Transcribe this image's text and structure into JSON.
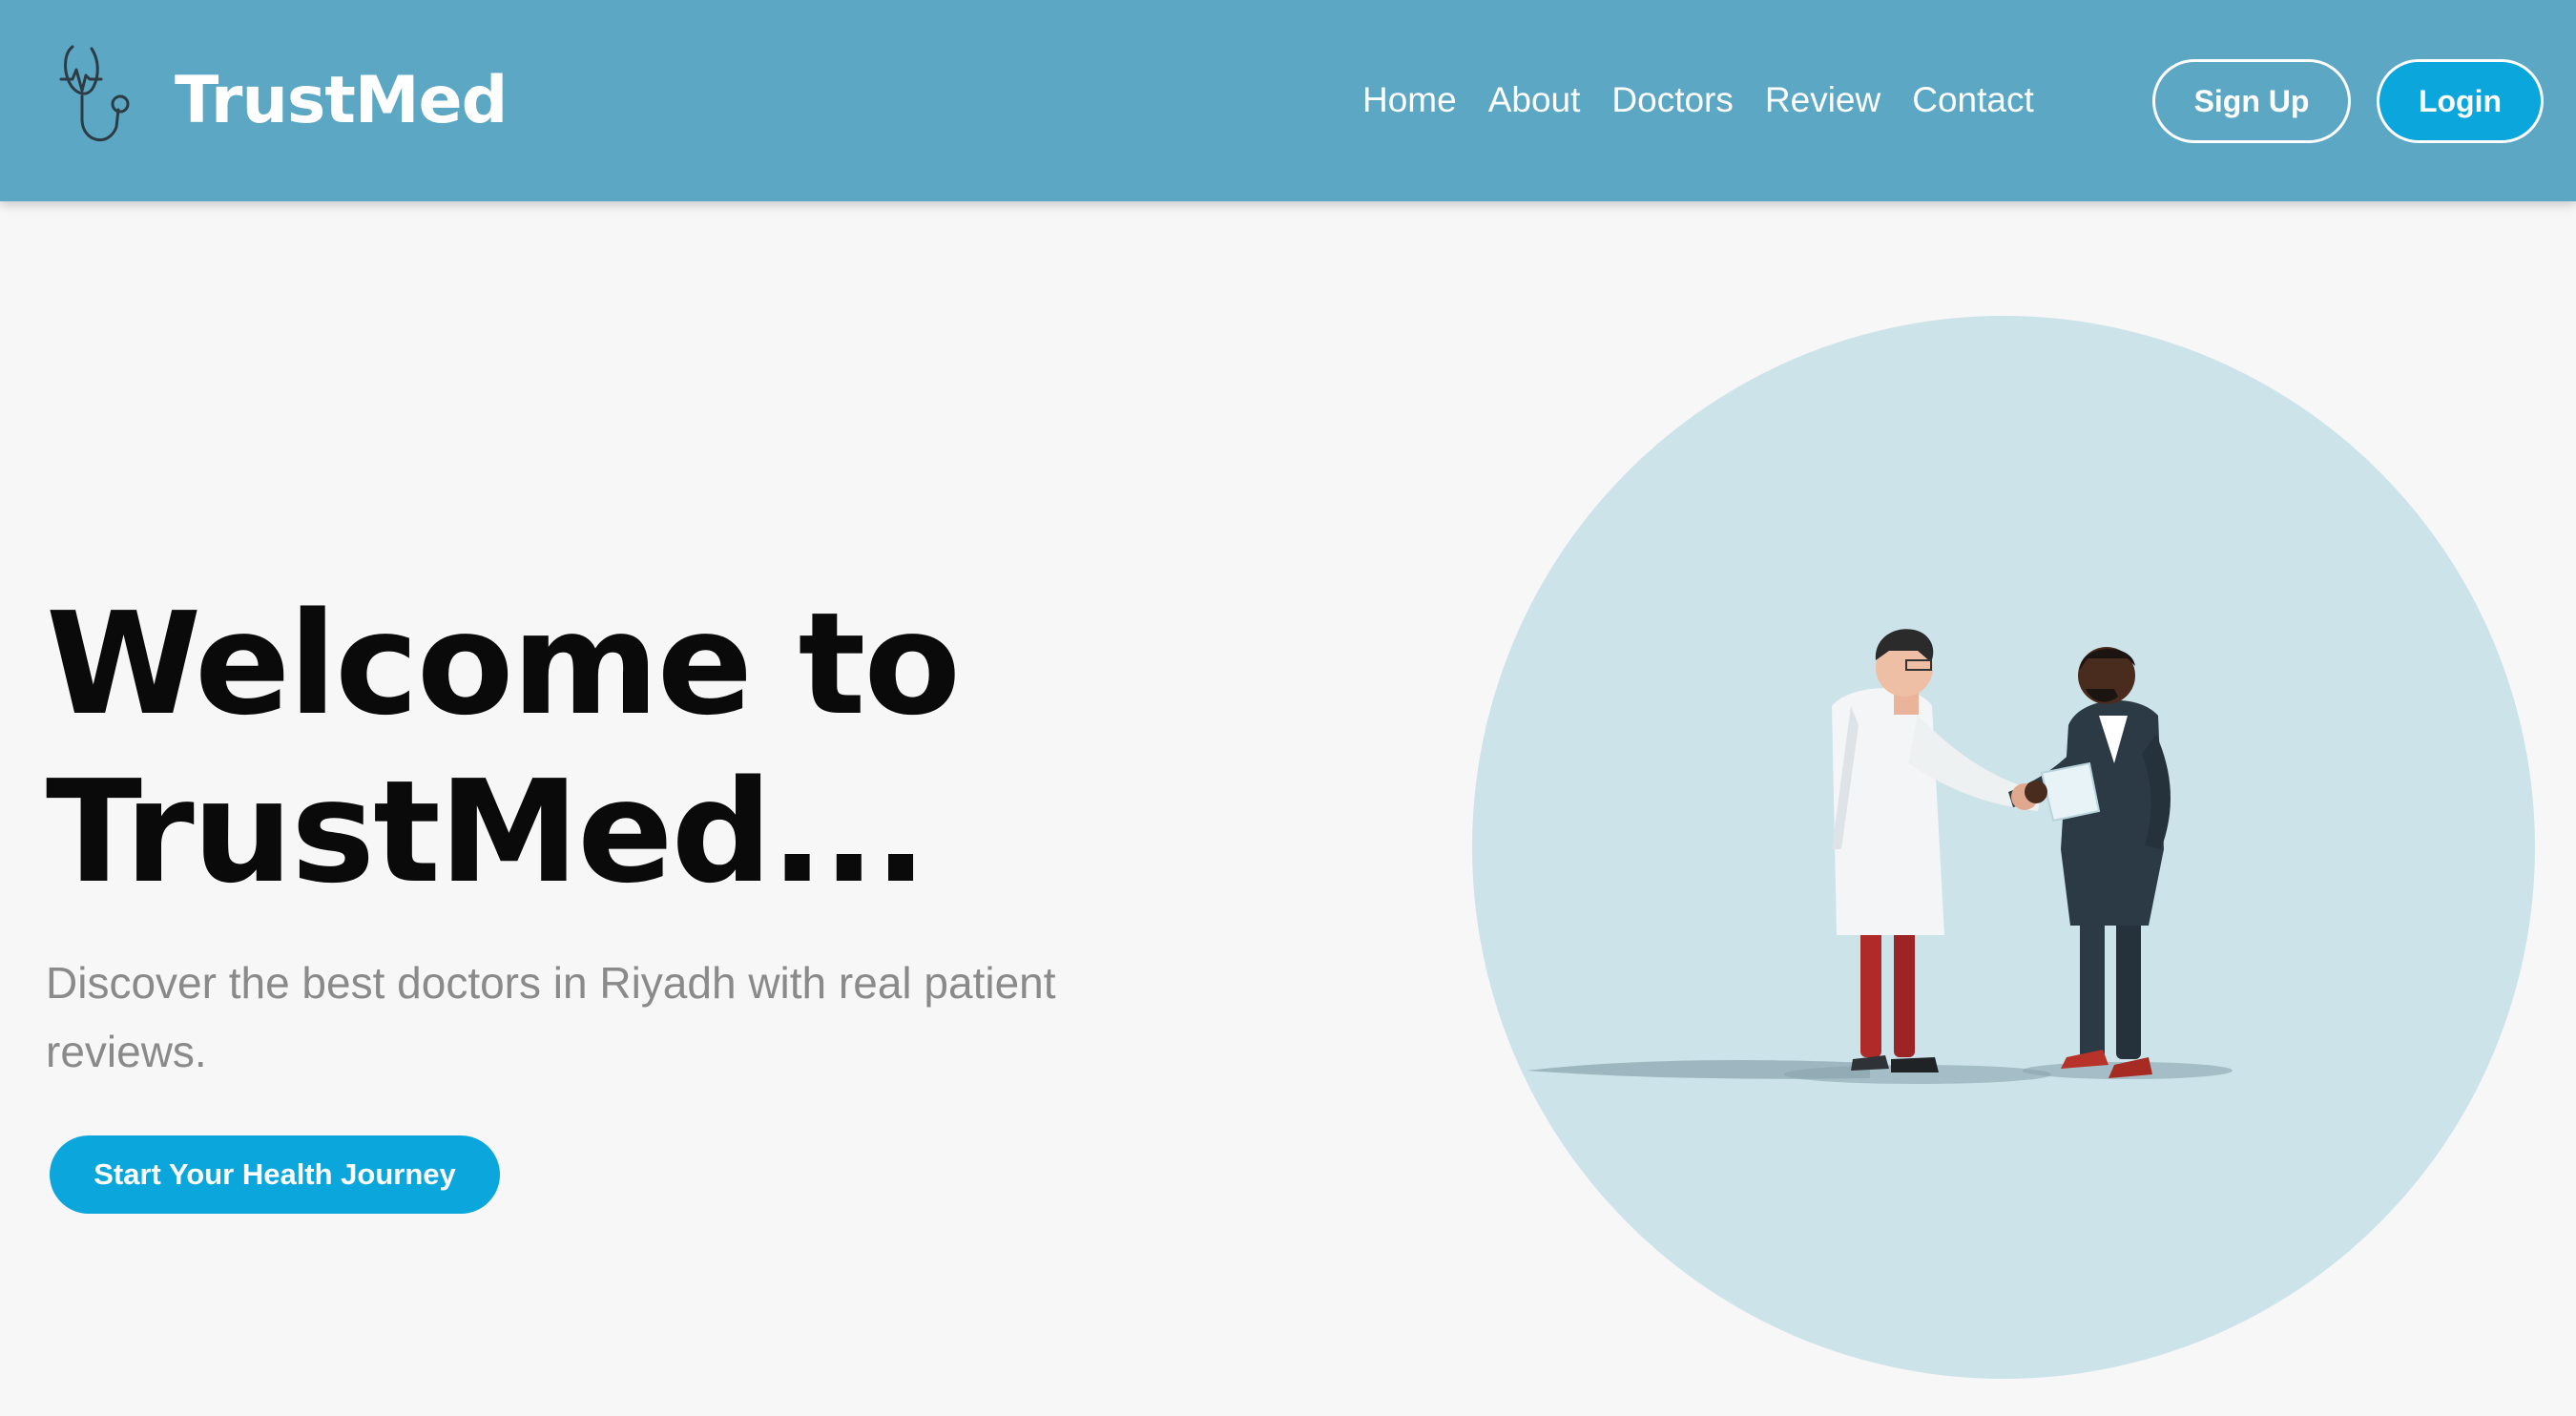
{
  "header": {
    "brand": "TrustMed",
    "logo_icon": "stethoscope-icon",
    "nav": [
      {
        "label": "Home"
      },
      {
        "label": "About"
      },
      {
        "label": "Doctors"
      },
      {
        "label": "Review"
      },
      {
        "label": "Contact"
      }
    ],
    "signup_label": "Sign Up",
    "login_label": "Login"
  },
  "hero": {
    "title": "Welcome to TrustMed...",
    "subtitle": "Discover the best doctors in Riyadh with real patient reviews.",
    "cta_label": "Start Your Health Journey",
    "illustration": "doctor-patient-handshake-illustration"
  },
  "colors": {
    "header_bg": "#5ca8c4",
    "accent": "#0aa6dc",
    "circle_bg": "#cde3ea",
    "page_bg": "#f7f7f7"
  }
}
